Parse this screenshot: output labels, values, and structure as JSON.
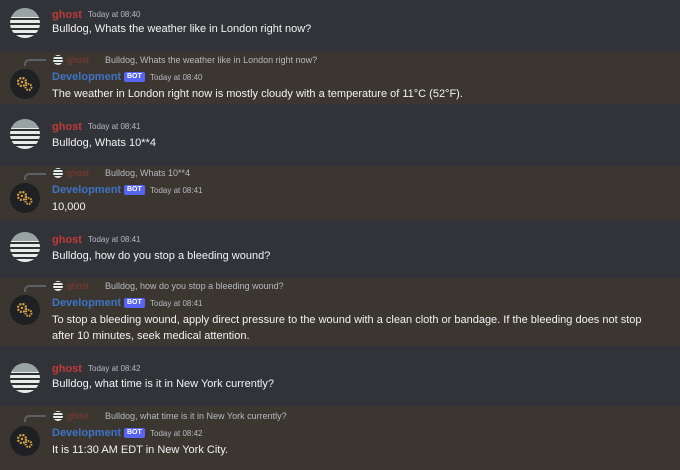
{
  "messages": [
    {
      "kind": "user",
      "author": "ghost",
      "timestamp": "Today at 08:40",
      "text": "Bulldog, Whats the weather like in London right now?"
    },
    {
      "kind": "bot",
      "reply_author": "ghost",
      "reply_text": "Bulldog, Whats the weather like in London right now?",
      "author": "Development",
      "badge": "BOT",
      "timestamp": "Today at 08:40",
      "text": "The weather in London right now is mostly cloudy with a temperature of 11°C (52°F)."
    },
    {
      "kind": "user",
      "author": "ghost",
      "timestamp": "Today at 08:41",
      "text": "Bulldog, Whats 10**4"
    },
    {
      "kind": "bot",
      "reply_author": "ghost",
      "reply_text": "Bulldog, Whats 10**4",
      "author": "Development",
      "badge": "BOT",
      "timestamp": "Today at 08:41",
      "text": "10,000"
    },
    {
      "kind": "user",
      "author": "ghost",
      "timestamp": "Today at 08:41",
      "text": "Bulldog, how do you stop a bleeding wound?"
    },
    {
      "kind": "bot",
      "reply_author": "ghost",
      "reply_text": "Bulldog, how do you stop a bleeding wound?",
      "author": "Development",
      "badge": "BOT",
      "timestamp": "Today at 08:41",
      "text": "To stop a bleeding wound, apply direct pressure to the wound with a clean cloth or bandage. If the bleeding does not stop after 10 minutes, seek medical attention."
    },
    {
      "kind": "user",
      "author": "ghost",
      "timestamp": "Today at 08:42",
      "text": "Bulldog, what time is it in New York currently?"
    },
    {
      "kind": "bot",
      "reply_author": "ghost",
      "reply_text": "Bulldog, what time is it in New York currently?",
      "author": "Development",
      "badge": "BOT",
      "timestamp": "Today at 08:42",
      "text": "It is 11:30 AM EDT in New York City."
    }
  ],
  "colors": {
    "background": "#313338",
    "bot_message_background": "#3b3630",
    "user_name": "#c23a35",
    "bot_name": "#3d74c7",
    "bot_badge": "#5865f2"
  },
  "icons": {
    "user_avatar": "ghost-avatar-icon",
    "bot_avatar": "gears-icon"
  }
}
